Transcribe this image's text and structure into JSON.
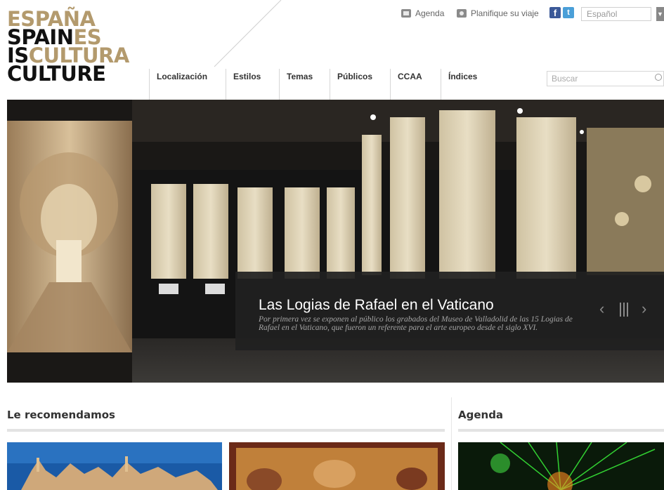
{
  "logo": {
    "line1": "ESPAÑA",
    "line2a": "SPAIN",
    "line2b": "ES",
    "line3a": "IS",
    "line3b": "CULTURA",
    "line4": "CULTURE"
  },
  "util": {
    "agenda_label": "Agenda",
    "plan_label": "Planifique su viaje",
    "language": "Español"
  },
  "nav": {
    "items": [
      "Localización",
      "Estilos",
      "Temas",
      "Públicos",
      "CCAA",
      "Índices"
    ]
  },
  "search": {
    "placeholder": "Buscar"
  },
  "hero": {
    "title": "Las Logias de Rafael en el Vaticano",
    "text": "Por primera vez se exponen al público los grabados del Museo de Valladolid de las 15 Logias de Rafael en el Vaticano, que fueron un referente para el arte europeo desde el siglo XVI."
  },
  "sections": {
    "recommend_title": "Le recomendamos",
    "agenda_title": "Agenda"
  },
  "icons": {
    "agenda": "calendar-icon",
    "plan": "camera-icon",
    "facebook": "facebook-icon",
    "twitter": "twitter-icon",
    "search": "search-icon"
  },
  "colors": {
    "gold": "#b39a6d",
    "facebook": "#3b5998",
    "twitter": "#4a9fd8"
  }
}
